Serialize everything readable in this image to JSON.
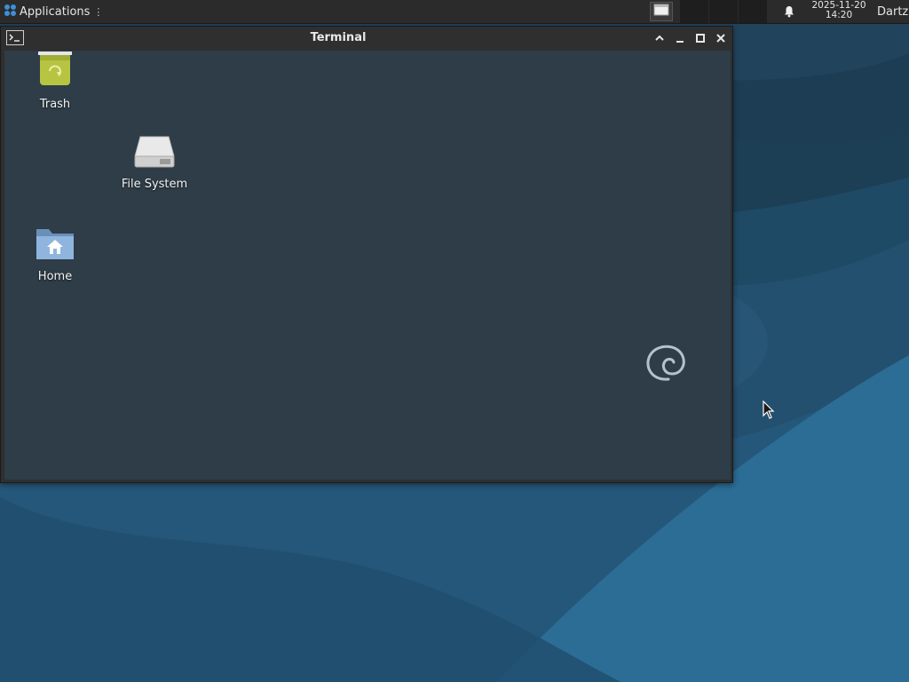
{
  "panel": {
    "apps_menu_label": "Applications",
    "apps_menu_glyph": "⋮",
    "clock_date": "2025-11-20",
    "clock_time": "14:20",
    "user_name": "Dartz"
  },
  "window": {
    "title": "Terminal",
    "buttons": [
      "chevron-up-icon",
      "minimize-icon",
      "maximize-icon",
      "close-icon"
    ]
  },
  "desktop": {
    "icons": [
      {
        "label": "Trash",
        "icon": "trash-icon"
      },
      {
        "label": "File System",
        "icon": "drive-icon"
      },
      {
        "label": "Home",
        "icon": "home-folder-icon"
      }
    ]
  },
  "colors": {
    "panel_bg": "#2b2b2b",
    "window_bg": "#2f2f2f",
    "wallpaper_dark": "#1f4a66",
    "wallpaper_light": "#2b6d95"
  }
}
